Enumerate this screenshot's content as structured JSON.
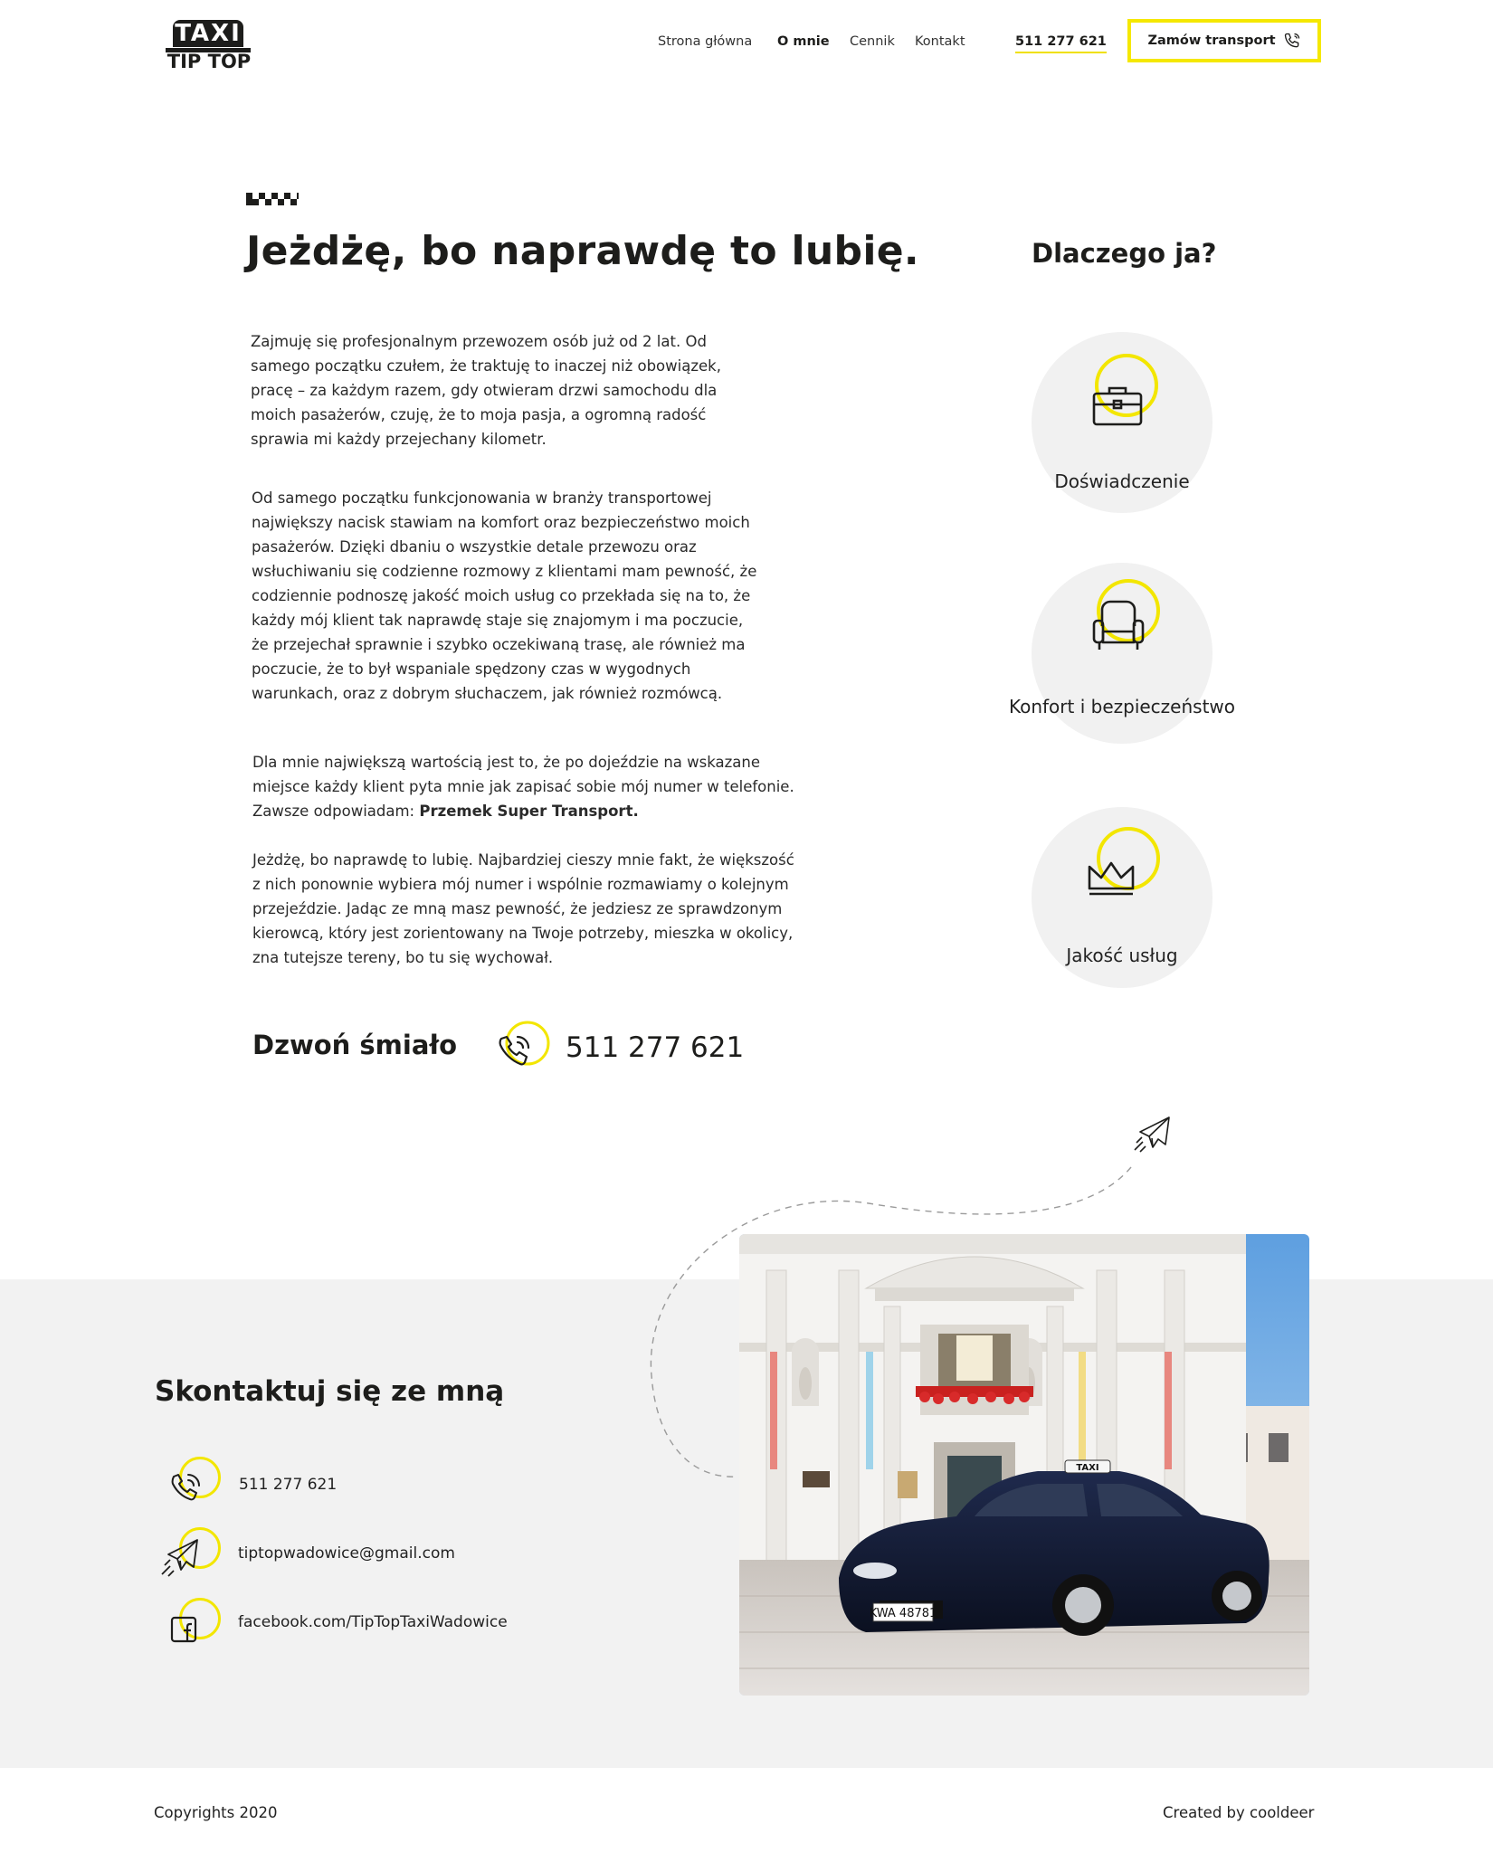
{
  "brand": {
    "logo_top": "TAXI",
    "logo_bottom": "TIP TOP"
  },
  "nav": {
    "items": [
      "Strona główna",
      "O mnie",
      "Cennik",
      "Kontakt"
    ],
    "active": "O mnie",
    "phone": "511 277 621",
    "order_label": "Zamów transport"
  },
  "about": {
    "title": "Jeżdżę, bo naprawdę to lubię.",
    "p1": "Zajmuję się profesjonalnym przewozem osób już od 2 lat. Od samego początku czułem, że traktuję to inaczej niż obowiązek, pracę – za każdym razem, gdy otwieram drzwi samochodu dla moich pasażerów, czuję, że to moja pasja, a ogromną radość sprawia mi każdy przejechany kilometr.",
    "p2": "Od samego początku funkcjonowania w branży transportowej największy nacisk stawiam na komfort oraz bezpieczeństwo moich pasażerów. Dzięki dbaniu o wszystkie detale przewozu oraz wsłuchiwaniu się codzienne rozmowy z klientami mam pewność, że codziennie podnoszę jakość moich usług co przekłada się na to, że każdy mój klient tak naprawdę staje się znajomym i ma poczucie, że przejechał sprawnie i szybko oczekiwaną trasę, ale również ma poczucie, że to był wspaniale spędzony czas w wygodnych warunkach, oraz z dobrym słuchaczem, jak również rozmówcą.",
    "p3_text": "Dla mnie największą wartością jest to, że po dojeździe na wskazane miejsce każdy klient pyta mnie jak zapisać sobie mój numer w telefonie. Zawsze odpowiadam: ",
    "p3_bold": "Przemek Super Transport.",
    "p4": "Jeżdżę, bo naprawdę to lubię. Najbardziej cieszy mnie fakt, że większość z nich ponownie wybiera mój numer i wspólnie rozmawiamy o kolejnym przejeździe. Jadąc ze mną masz pewność, że jedziesz ze sprawdzonym kierowcą, który jest zorientowany na Twoje potrzeby, mieszka w okolicy, zna tutejsze tereny, bo tu się wychował.",
    "call_label": "Dzwoń śmiało",
    "call_number": "511 277 621"
  },
  "why": {
    "title": "Dlaczego ja?",
    "features": [
      {
        "label": "Doświadczenie",
        "icon": "briefcase-icon"
      },
      {
        "label": "Konfort i bezpieczeństwo",
        "icon": "armchair-icon"
      },
      {
        "label": "Jakość usług",
        "icon": "crown-icon"
      }
    ]
  },
  "contact": {
    "title": "Skontaktuj się ze mną",
    "phone": "511 277 621",
    "email": "tiptopwadowice@gmail.com",
    "facebook": "facebook.com/TipTopTaxiWadowice",
    "plate": "KWA 48781",
    "car_sign": "TAXI"
  },
  "footer": {
    "left": "Copyrights 2020",
    "right": "Created by cooldeer"
  },
  "colors": {
    "accent": "#f3e600",
    "text": "#1d1d1b",
    "section_bg": "#f2f2f2"
  }
}
